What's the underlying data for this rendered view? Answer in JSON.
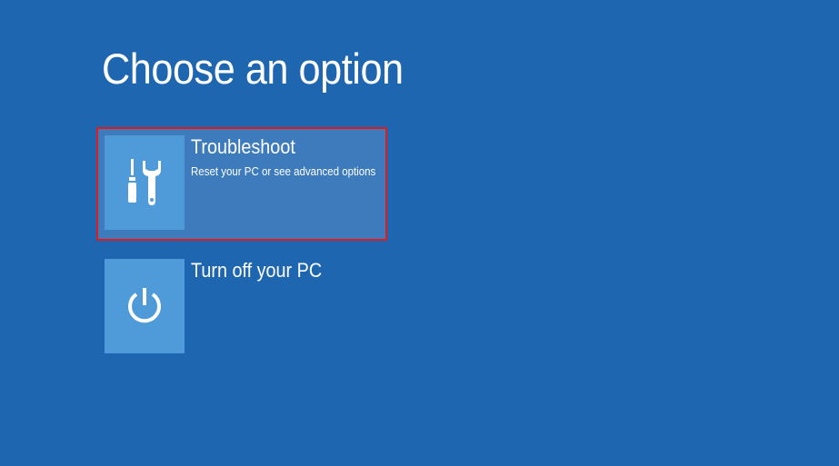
{
  "title": "Choose an option",
  "options": [
    {
      "label": "Troubleshoot",
      "description": "Reset your PC or see advanced options",
      "icon": "tools-icon",
      "selected": true
    },
    {
      "label": "Turn off your PC",
      "description": "",
      "icon": "power-icon",
      "selected": false
    }
  ],
  "colors": {
    "background": "#1f66b0",
    "tile": "#4f9ad9",
    "selected_background": "#3e7bbd",
    "selection_border": "#e21a1a",
    "text": "#ffffff"
  }
}
